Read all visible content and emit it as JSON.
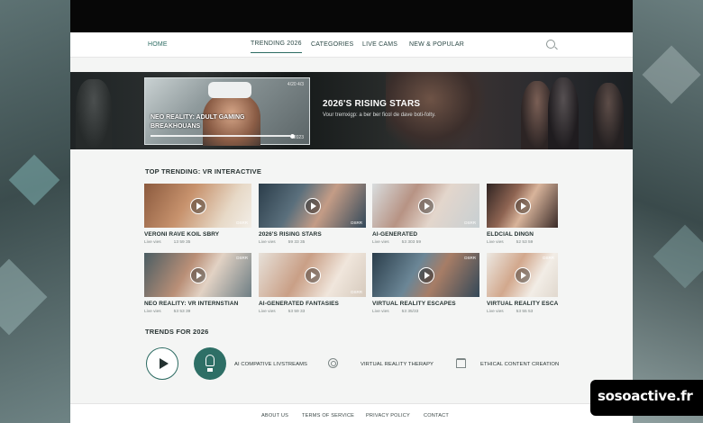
{
  "nav": {
    "home": "HOME",
    "items": [
      "TRENDING 2026",
      "CATEGORIES",
      "LIVE CAMS",
      "NEW & POPULAR"
    ]
  },
  "hero": {
    "feature_title": "NEO REALITY: ADULT GAMING BREAKHOUANS",
    "feature_tag": "4/20 4/3",
    "feature_year": "2023",
    "rising_title": "2026'S RISING STARS",
    "rising_sub": "Vour tremxigp: a ber ber ficol de dave boti-folty.",
    "progress": 0.9
  },
  "trending": {
    "title": "TOP TRENDING: VR INTERACTIVE",
    "cards": [
      {
        "title": "VERONI RAVE KOIL SBRY",
        "views": "Live vies",
        "stat": "13 59 35",
        "badge": "DSRR",
        "badge_top": ""
      },
      {
        "title": "2026'S RISING STARS",
        "views": "Live vies",
        "stat": "59 33 35",
        "badge": "DSRR",
        "badge_top": ""
      },
      {
        "title": "AI-GENERATED",
        "views": "Live vies",
        "stat": "53 303 59",
        "badge": "DSRR",
        "badge_top": ""
      },
      {
        "title": "ELDCIAL DINGN",
        "views": "Live vies",
        "stat": "52 53 59",
        "badge": "",
        "badge_top": ""
      },
      {
        "title": "NEO REALITY: VR INTERNSTIAN",
        "views": "Live vies",
        "stat": "53 53 39",
        "badge": "",
        "badge_top": "DSRR"
      },
      {
        "title": "AI-GENERATED FANTASIES",
        "views": "Live vies",
        "stat": "53 59 33",
        "badge": "DSRR",
        "badge_top": ""
      },
      {
        "title": "VIRTUAL REALITY ESCAPES",
        "views": "Live vies",
        "stat": "53 35/33",
        "badge": "",
        "badge_top": "DSRR"
      },
      {
        "title": "VIRTUAL REALITY ESCAPE",
        "views": "Live vies",
        "stat": "53 55 53",
        "badge": "",
        "badge_top": "DSRR"
      }
    ]
  },
  "trends": {
    "title": "TRENDS FOR 2026",
    "items": [
      {
        "label": "AI COMPATIVE LIVSTREAMS",
        "icon": "lightbulb-icon"
      },
      {
        "label": "VIRTUAL REALITY THERAPY",
        "icon": "brain-icon"
      },
      {
        "label": "ETHICAL CONTENT CREATION",
        "icon": "shield-icon"
      }
    ]
  },
  "footer": {
    "links": [
      "ABOUT US",
      "TERMS OF SERVICE",
      "PRIVACY POLICY",
      "CONTACT"
    ]
  },
  "watermark": "sosoactive.fr",
  "colors": {
    "accent": "#2c6b62",
    "topbar": "#070707",
    "page_bg": "#f4f5f4"
  }
}
